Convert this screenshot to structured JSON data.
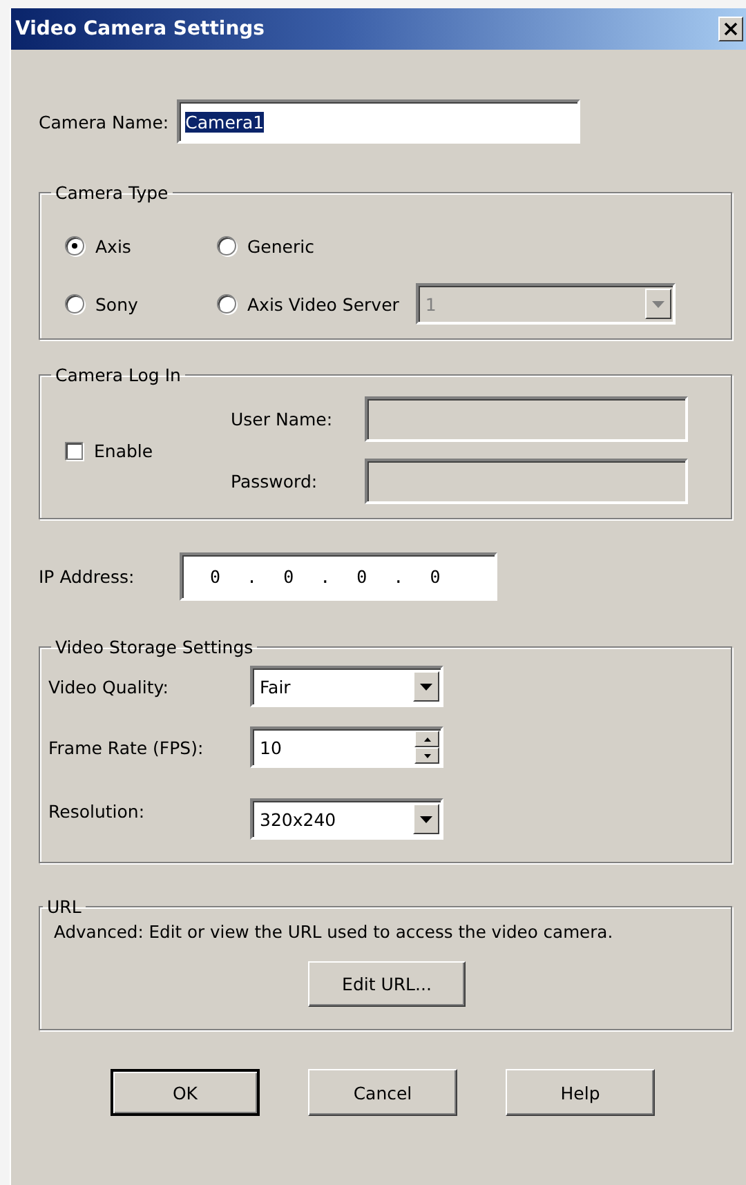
{
  "window": {
    "title": "Video Camera Settings"
  },
  "camera_name": {
    "label": "Camera Name:",
    "value": "Camera1",
    "text_selected": true
  },
  "camera_type": {
    "title": "Camera Type",
    "options": [
      {
        "label": "Axis",
        "selected": true
      },
      {
        "label": "Generic",
        "selected": false
      },
      {
        "label": "Sony",
        "selected": false
      },
      {
        "label": "Axis Video Server",
        "selected": false
      }
    ],
    "server_dropdown": {
      "value": "1",
      "disabled": true
    }
  },
  "camera_log_in": {
    "title": "Camera Log In",
    "enable": {
      "label": "Enable",
      "checked": false
    },
    "fields": [
      {
        "label": "User Name:",
        "disabled": true
      },
      {
        "label": "Password:",
        "disabled": true
      }
    ]
  },
  "ip_address": {
    "label": "IP Address:",
    "octets": [
      "0",
      "0",
      "0",
      "0"
    ],
    "separator": "."
  },
  "video_storage_settings": {
    "title": "Video Storage Settings",
    "settings": [
      {
        "kind": "dropdown",
        "label": "Video Quality:",
        "value": "Fair"
      },
      {
        "kind": "spinner",
        "label": "Frame Rate (FPS):",
        "value": "10"
      },
      {
        "kind": "dropdown",
        "label": "Resolution:",
        "value": "320x240"
      }
    ]
  },
  "url": {
    "title": "URL",
    "description": "Advanced: Edit or view the URL used to access the video camera.",
    "button": "Edit URL..."
  },
  "buttons": [
    {
      "label": "OK",
      "default": true
    },
    {
      "label": "Cancel",
      "default": false
    },
    {
      "label": "Help",
      "default": false
    }
  ]
}
